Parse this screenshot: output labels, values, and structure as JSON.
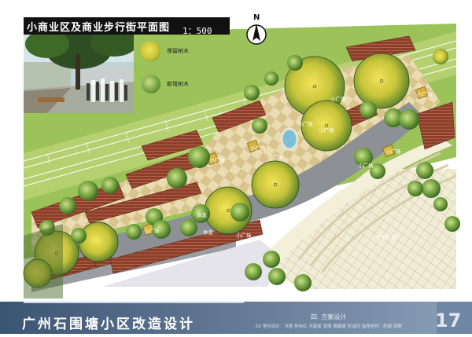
{
  "header": {
    "title": "小商业区及商业步行街平面图",
    "scale": "1：500",
    "north_label": "N"
  },
  "legend": {
    "retained_trees": "保留树木",
    "new_trees": "新增树木"
  },
  "plan_labels": {
    "small_square_1": "小广场",
    "small_square_2": "小广场",
    "small_square_3": "小广场",
    "small_square_4": "小广场",
    "small_square_5": "小广场",
    "small_square_6": "小广场",
    "small_square_7": "小广场",
    "small_square_8": "小广场",
    "small_square_9": "小广场",
    "rest_area_1": "休息",
    "rest_area_2": "休息",
    "lower_plaza": "下沉广场",
    "small_plaza": "小广场",
    "shop_strip": "小广场"
  },
  "footer": {
    "project_title": "广州石围塘小区改造设计",
    "section_label": "四. 方案设计",
    "credits": "05 室内设计：冯慧 林伟红 冯嘉俊 曾倩 袁敏捷 彭洁珂    指导老师：陈颖 周群",
    "page_number": "17"
  },
  "colors": {
    "footer_band": "#5b7391",
    "grass": "#9fc15a",
    "paving": "#e6d7ac",
    "road": "#8f9398",
    "roof": "#9a4a34"
  }
}
